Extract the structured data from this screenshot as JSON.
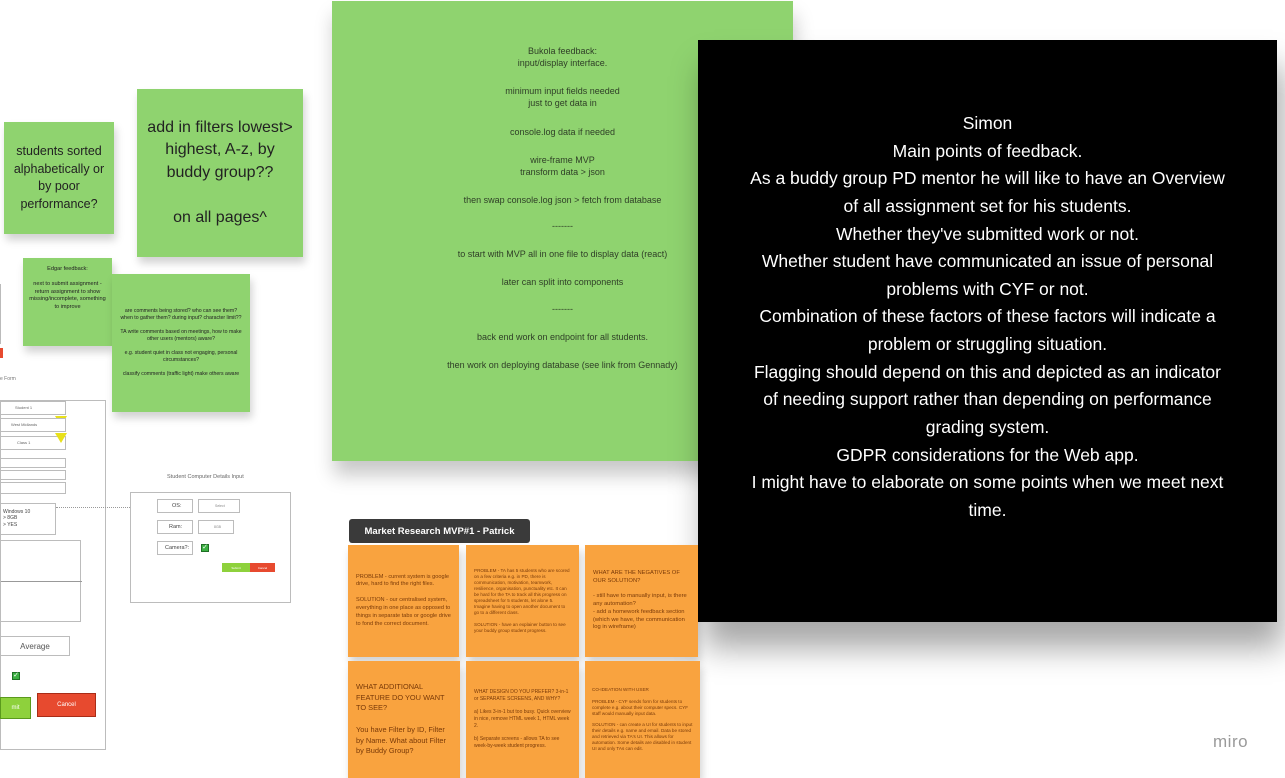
{
  "board": {
    "brand": "miro",
    "colors": {
      "green_note": "#8fd36f",
      "orange_note": "#f9a33f",
      "black_note": "#000000",
      "submit": "#8ed13c",
      "cancel": "#e74a2f",
      "market_header": "#3a3a3a"
    }
  },
  "notes": {
    "students_sorted": "students sorted alphabetically or by poor performance?",
    "add_filters": "add in filters lowest> highest, A-z, by buddy group??\n\non all pages^",
    "edgar_feedback": "Edgar feedback:\n\nnext to submit assignment - return assignment to show missing/incomplete, something to improve",
    "comments_note": "are comments being stored? who can see them? when to gather them? during input? character limit??\n\nTA write comments based on meetings, how to make other users (mentors) aware?\n\ne.g. student quiet in class not engaging, personal circumstances?\n\nclassify comments (traffic light) make others aware",
    "bukola": [
      "Bukola feedback:\ninput/display interface.",
      "minimum input fields needed\njust to get data in",
      "console.log data if needed",
      "wire-frame MVP\ntransform data > json",
      "then swap console.log json > fetch from database",
      "-------",
      "to start with MVP all in one file to display data (react)",
      "later can split into components",
      "-------",
      "back end work on endpoint for all students.",
      "then work on deploying database (see link from Gennady)"
    ],
    "simon": [
      "Simon",
      "Main points of feedback.",
      "As a buddy group PD mentor he will like to have an Overview of all assignment set for his students.",
      "Whether they've submitted work or not.",
      "Whether student have communicated an issue of personal problems with CYF or not.",
      "Combination of these factors of these factors will indicate a problem or struggling situation.",
      "Flagging should depend on this and depicted as an indicator of needing support rather than depending on performance grading system.",
      "GDPR considerations for the Web app.",
      "I might have to elaborate on some points when we meet next time."
    ]
  },
  "market": {
    "header": "Market Research MVP#1 - Patrick",
    "cards": [
      "PROBLEM - current system is google drive, hard to find the right files.\n\nSOLUTION - our centralised system, everything in one place as opposed to things in separate tabs or google drive to fond the correct document.",
      "PROBLEM - TA has 5 students who are scored on a few criteria e.g. in PD, there is communication, motivation, teamwork, resilience, organisation, punctuality etc. It can be hard for the TA to track all this progress on spreadsheet for 5 students, let alone 5. Imagine having to open another document to go to a different class.\n\nSOLUTION - have an explainer button to see your buddy group student progress.",
      "WHAT ARE THE NEGATIVES OF OUR SOLUTION?\n\n- still have to manually input, is there any automation?\n- add a homework feedback section (which we have, the communication log in wireframe)",
      "WHAT ADDITIONAL FEATURE DO YOU WANT TO SEE?\n\nYou have Filter by ID, Filter by Name. What about Filter by Buddy Group?",
      "WHAT DESIGN DO YOU PREFER? 3-in-1 or SEPARATE SCREENS, AND WHY?\n\na) Likes 3-in-1 but too busy. Quick overview in nice, remove HTML week 1, HTML week 2.\n\nb) Separate screens - allows TA to see week-by-week student progress.",
      "CO-IDEATION WITH USER\n\nPROBLEM - CYF sends form for students to complete e.g. about their computer specs. CYF staff would manually input data.\n\nSOLUTION - can create a UI for students to input their details e.g. name and email. Data be stored and retrieved via TA's UI. This allows for automation. Some details are disabled in student UI and only TAs can edit."
    ]
  },
  "wireframe_left": {
    "form_label": "e Form",
    "student_select": "Student 1",
    "region_select": "West Midlands",
    "class_select": "Class 1",
    "os_text": "Windows 10\n> 8GB\n> YES",
    "average_label": "Average",
    "submit_label": "mit",
    "cancel_label": "Cancel"
  },
  "wireframe_computer": {
    "title": "Student Computer Details Input",
    "os_label": "OS:",
    "os_value": "Select",
    "ram_label": "Ram:",
    "ram_value": "8GB",
    "camera_label": "Camera?:",
    "submit_label": "Submit",
    "cancel_label": "Cancel"
  }
}
